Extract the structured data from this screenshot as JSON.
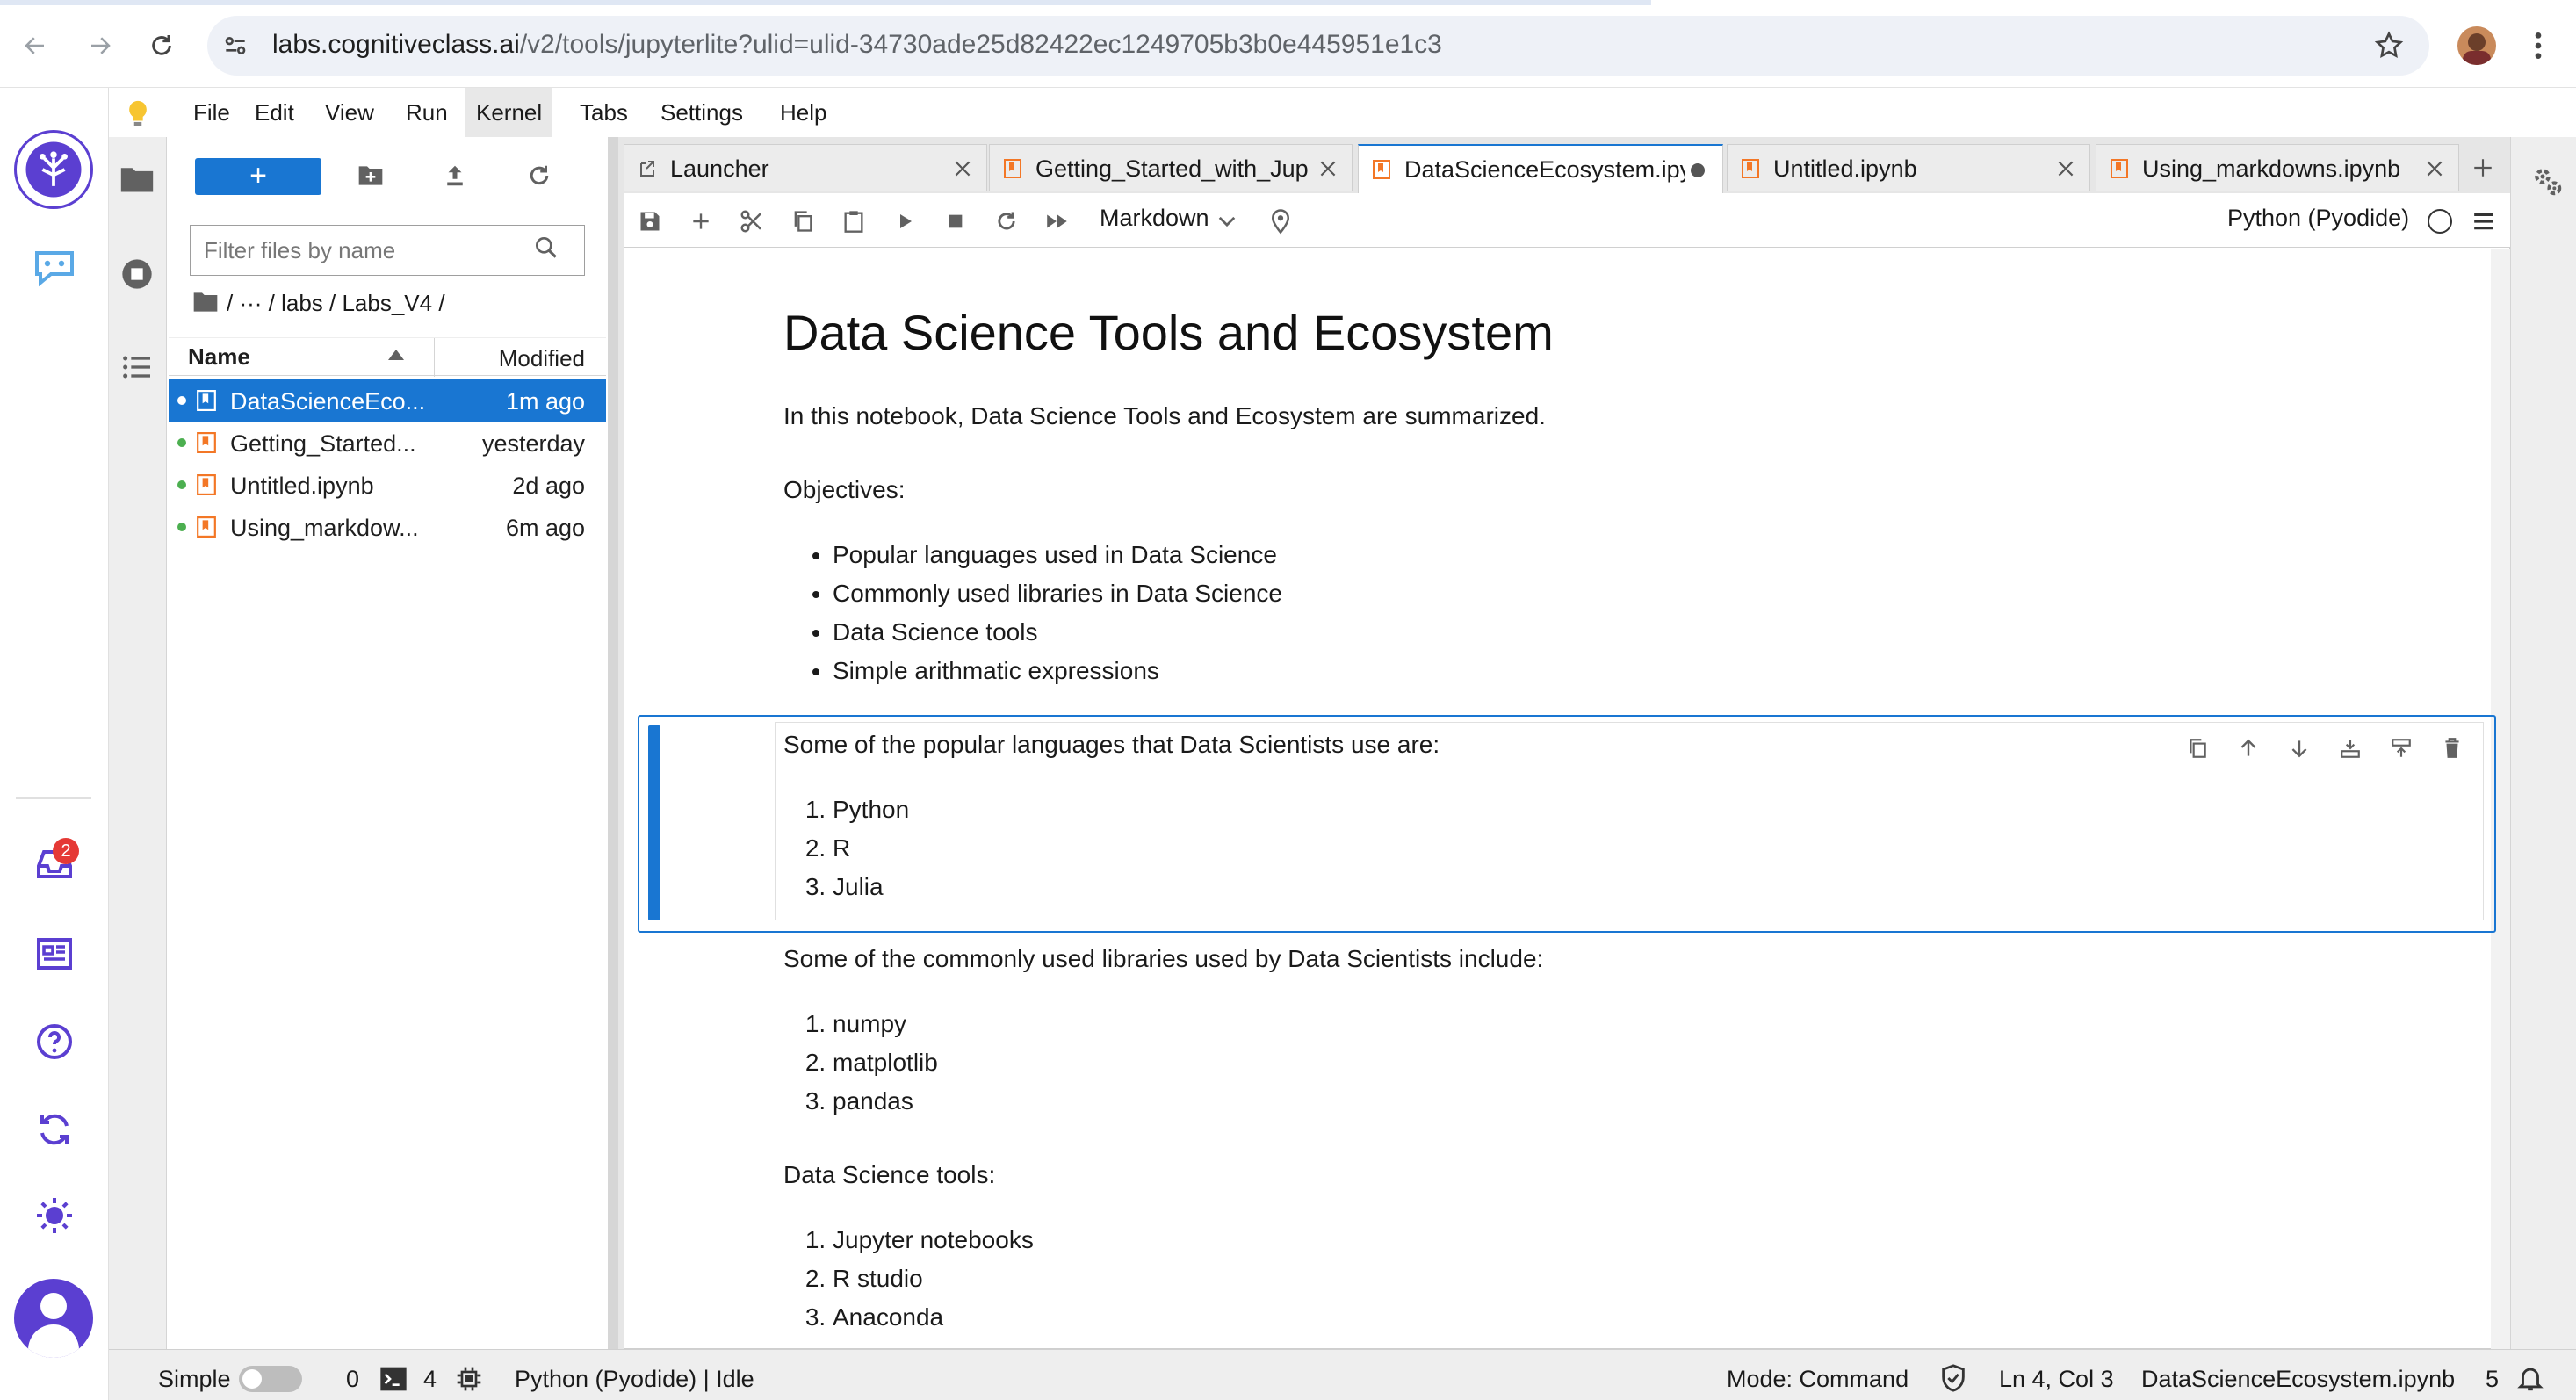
{
  "browser": {
    "url_host": "labs.cognitiveclass.ai",
    "url_path": "/v2/tools/jupyterlite?ulid=ulid-34730ade25d82422ec1249705b3b0e445951e1c3"
  },
  "menubar": {
    "items": [
      "File",
      "Edit",
      "View",
      "Run",
      "Kernel",
      "Tabs",
      "Settings",
      "Help"
    ],
    "active": "Kernel"
  },
  "activity_bar": {
    "inbox_badge": "2"
  },
  "filebrowser": {
    "new_label": "+",
    "filter_placeholder": "Filter files by name",
    "breadcrumb": "/ ··· / labs / Labs_V4 /",
    "col_name": "Name",
    "col_modified": "Modified",
    "files": [
      {
        "name": "DataScienceEco...",
        "modified": "1m ago",
        "selected": true
      },
      {
        "name": "Getting_Started...",
        "modified": "yesterday",
        "selected": false
      },
      {
        "name": "Untitled.ipynb",
        "modified": "2d ago",
        "selected": false
      },
      {
        "name": "Using_markdow...",
        "modified": "6m ago",
        "selected": false
      }
    ]
  },
  "tabs": [
    {
      "label": "Launcher",
      "kind": "launcher",
      "active": false
    },
    {
      "label": "Getting_Started_with_Jup",
      "kind": "notebook",
      "active": false
    },
    {
      "label": "DataScienceEcosystem.ipy",
      "kind": "notebook",
      "active": true,
      "dirty": true
    },
    {
      "label": "Untitled.ipynb",
      "kind": "notebook",
      "active": false
    },
    {
      "label": "Using_markdowns.ipynb",
      "kind": "notebook",
      "active": false
    }
  ],
  "toolbar": {
    "cell_type": "Markdown",
    "kernel": "Python (Pyodide)"
  },
  "notebook": {
    "title": "Data Science Tools and Ecosystem",
    "intro": "In this notebook, Data Science Tools and Ecosystem are summarized.",
    "objectives_label": "Objectives:",
    "objectives": [
      "Popular languages used in Data Science",
      "Commonly used libraries in Data Science",
      "Data Science tools",
      "Simple arithmatic expressions"
    ],
    "languages_intro": "Some of the popular languages that Data Scientists use are:",
    "languages": [
      "Python",
      "R",
      "Julia"
    ],
    "libraries_intro": "Some of the commonly used libraries used by Data Scientists include:",
    "libraries": [
      "numpy",
      "matplotlib",
      "pandas"
    ],
    "tools_intro": "Data Science tools:",
    "tools": [
      "Jupyter notebooks",
      "R studio",
      "Anaconda"
    ]
  },
  "statusbar": {
    "mode_label": "Simple",
    "terminals": "0",
    "kernels": "4",
    "kernel_status": "Python (Pyodide) | Idle",
    "mode": "Mode: Command",
    "cursor": "Ln 4, Col 3",
    "file": "DataScienceEcosystem.ipynb",
    "notifications": "5"
  },
  "colors": {
    "accent": "#1976d2",
    "activity_purple": "#5b3fd1",
    "notebook_icon": "#f37726",
    "badge_red": "#e53935"
  }
}
